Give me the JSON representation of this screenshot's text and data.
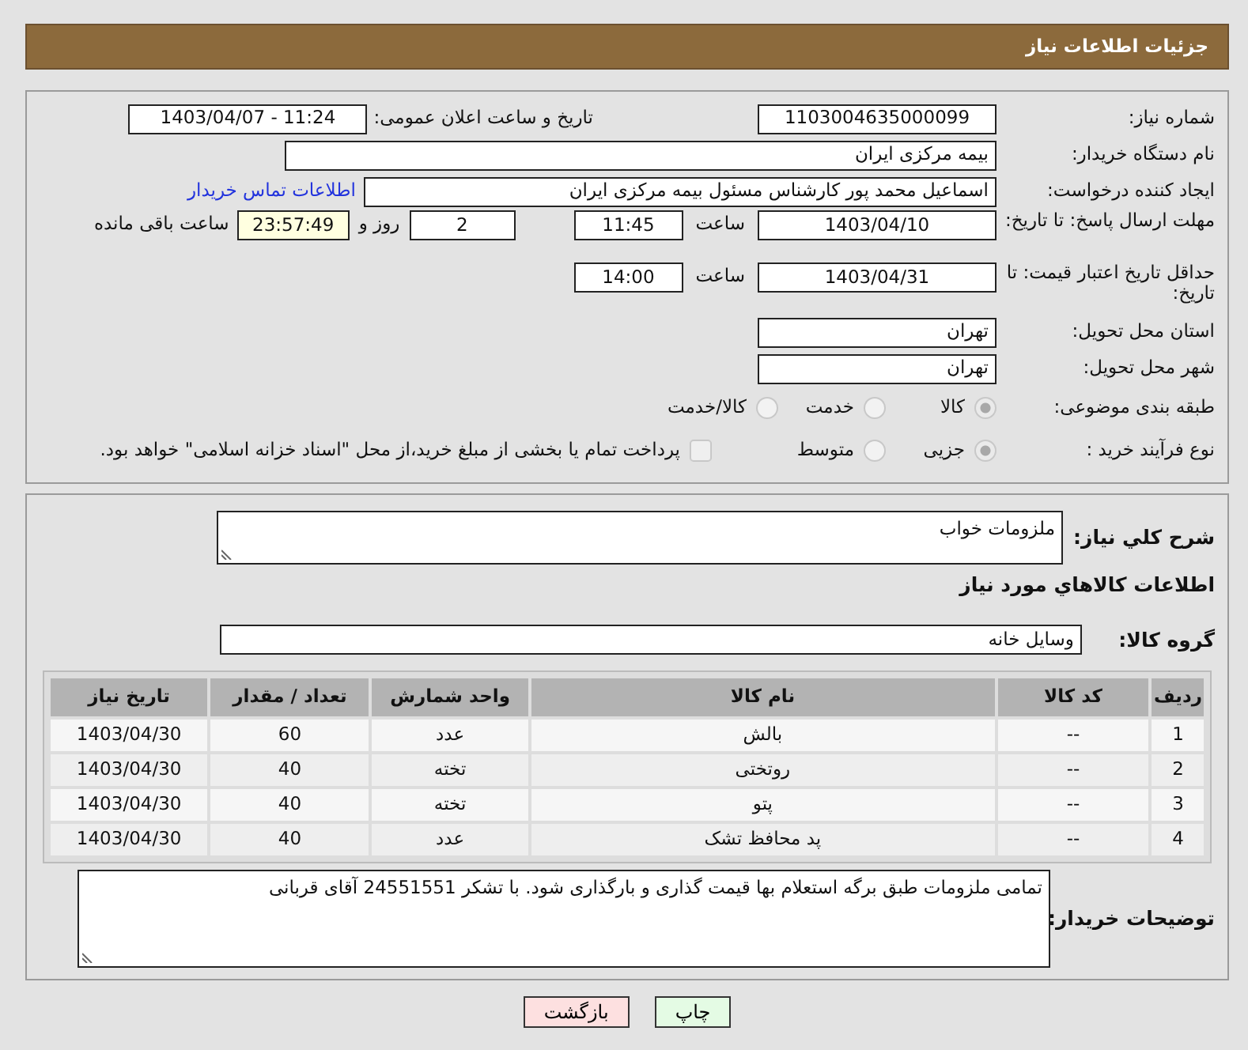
{
  "header": {
    "title": "جزئیات اطلاعات نیاز"
  },
  "need_number": {
    "label": "شماره نیاز:",
    "value": "1103004635000099"
  },
  "announce": {
    "label": "تاریخ و ساعت اعلان عمومی:",
    "value": "1403/04/07 - 11:24"
  },
  "buyer": {
    "label": "نام دستگاه خریدار:",
    "value": "بیمه مرکزی ایران"
  },
  "requester": {
    "label": "ایجاد کننده درخواست:",
    "value": "اسماعیل محمد پور  کارشناس مسئول  بیمه مرکزی ایران",
    "link": "اطلاعات تماس خریدار"
  },
  "deadline": {
    "label": "مهلت ارسال پاسخ: تا تاریخ:",
    "date": "1403/04/10",
    "time_label": "ساعت",
    "time": "11:45",
    "days": "2",
    "days_label": "روز و",
    "remaining": "23:57:49",
    "remaining_label": "ساعت باقی مانده"
  },
  "validity": {
    "label": "حداقل تاریخ اعتبار قیمت: تا تاریخ:",
    "date": "1403/04/31",
    "time_label": "ساعت",
    "time": "14:00"
  },
  "province": {
    "label": "استان محل تحویل:",
    "value": "تهران"
  },
  "city": {
    "label": "شهر محل تحویل:",
    "value": "تهران"
  },
  "category": {
    "label": "طبقه بندی موضوعی:",
    "options": [
      {
        "label": "کالا",
        "selected": true
      },
      {
        "label": "خدمت",
        "selected": false
      },
      {
        "label": "کالا/خدمت",
        "selected": false
      }
    ]
  },
  "purchase_type": {
    "label": "نوع فرآیند خرید :",
    "options": [
      {
        "label": "جزیی",
        "selected": true
      },
      {
        "label": "متوسط",
        "selected": false
      }
    ],
    "payment": {
      "label": "پرداخت تمام یا بخشی از مبلغ خرید،از محل \"اسناد خزانه اسلامی\" خواهد بود.",
      "checked": false
    }
  },
  "description": {
    "label": "شرح کلي نياز:",
    "value": "ملزومات خواب"
  },
  "items_heading": "اطلاعات کالاهاي مورد نياز",
  "group": {
    "label": "گروه کالا:",
    "value": "وسایل خانه"
  },
  "table": {
    "columns": [
      "ردیف",
      "کد کالا",
      "نام کالا",
      "واحد شمارش",
      "تعداد / مقدار",
      "تاریخ نیاز"
    ],
    "rows": [
      [
        "1",
        "--",
        "بالش",
        "عدد",
        "60",
        "1403/04/30"
      ],
      [
        "2",
        "--",
        "روتختی",
        "تخته",
        "40",
        "1403/04/30"
      ],
      [
        "3",
        "--",
        "پتو",
        "تخته",
        "40",
        "1403/04/30"
      ],
      [
        "4",
        "--",
        "پد محافظ تشک",
        "عدد",
        "40",
        "1403/04/30"
      ]
    ]
  },
  "buyer_notes": {
    "label": "توضیحات خریدار:",
    "value": "تمامی ملزومات طبق برگه استعلام بها قیمت گذاری و بارگذاری شود. با تشکر 24551551 آقای قربانی"
  },
  "buttons": [
    {
      "label": "چاپ",
      "kind": "print"
    },
    {
      "label": "بازگشت",
      "kind": "back"
    }
  ]
}
